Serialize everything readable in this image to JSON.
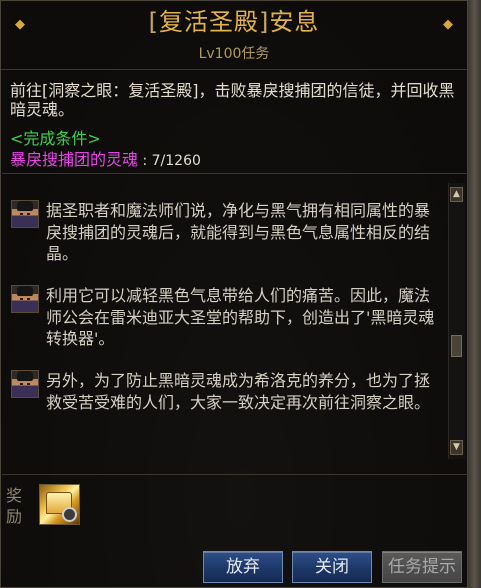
{
  "header": {
    "bracket_open": "[",
    "location": "复活圣殿",
    "bracket_close": "]",
    "quest_name": "安息",
    "subtitle": "Lv100任务"
  },
  "objective": {
    "text": "前往[洞察之眼：复活圣殿]，击败暴戾搜捕团的信徒，并回收黑暗灵魂。",
    "condition_title": "<完成条件>",
    "condition_target": "暴戾搜捕团的灵魂",
    "condition_progress": " : 7/1260"
  },
  "dialogue": [
    {
      "text": "据圣职者和魔法师们说，净化与黑气拥有相同属性的暴戾搜捕团的灵魂后，就能得到与黑色气息属性相反的结晶。"
    },
    {
      "text": "利用它可以减轻黑色气息带给人们的痛苦。因此，魔法师公会在雷米迪亚大圣堂的帮助下，创造出了'黑暗灵魂转换器'。"
    },
    {
      "text": "另外，为了防止黑暗灵魂成为希洛克的养分，也为了拯救受苦受难的人们，大家一致决定再次前往洞察之眼。"
    }
  ],
  "scroll": {
    "up_glyph": "▲",
    "down_glyph": "▼"
  },
  "reward": {
    "label": "奖励",
    "item_icon": "golden-chest-icon"
  },
  "buttons": {
    "abandon": "放弃",
    "close": "关闭",
    "hint": "任务提示"
  },
  "colors": {
    "title": "#e4b24a",
    "condition_title": "#3fcf52",
    "condition_target": "#e447e6",
    "button_blue": "#1d3868"
  }
}
